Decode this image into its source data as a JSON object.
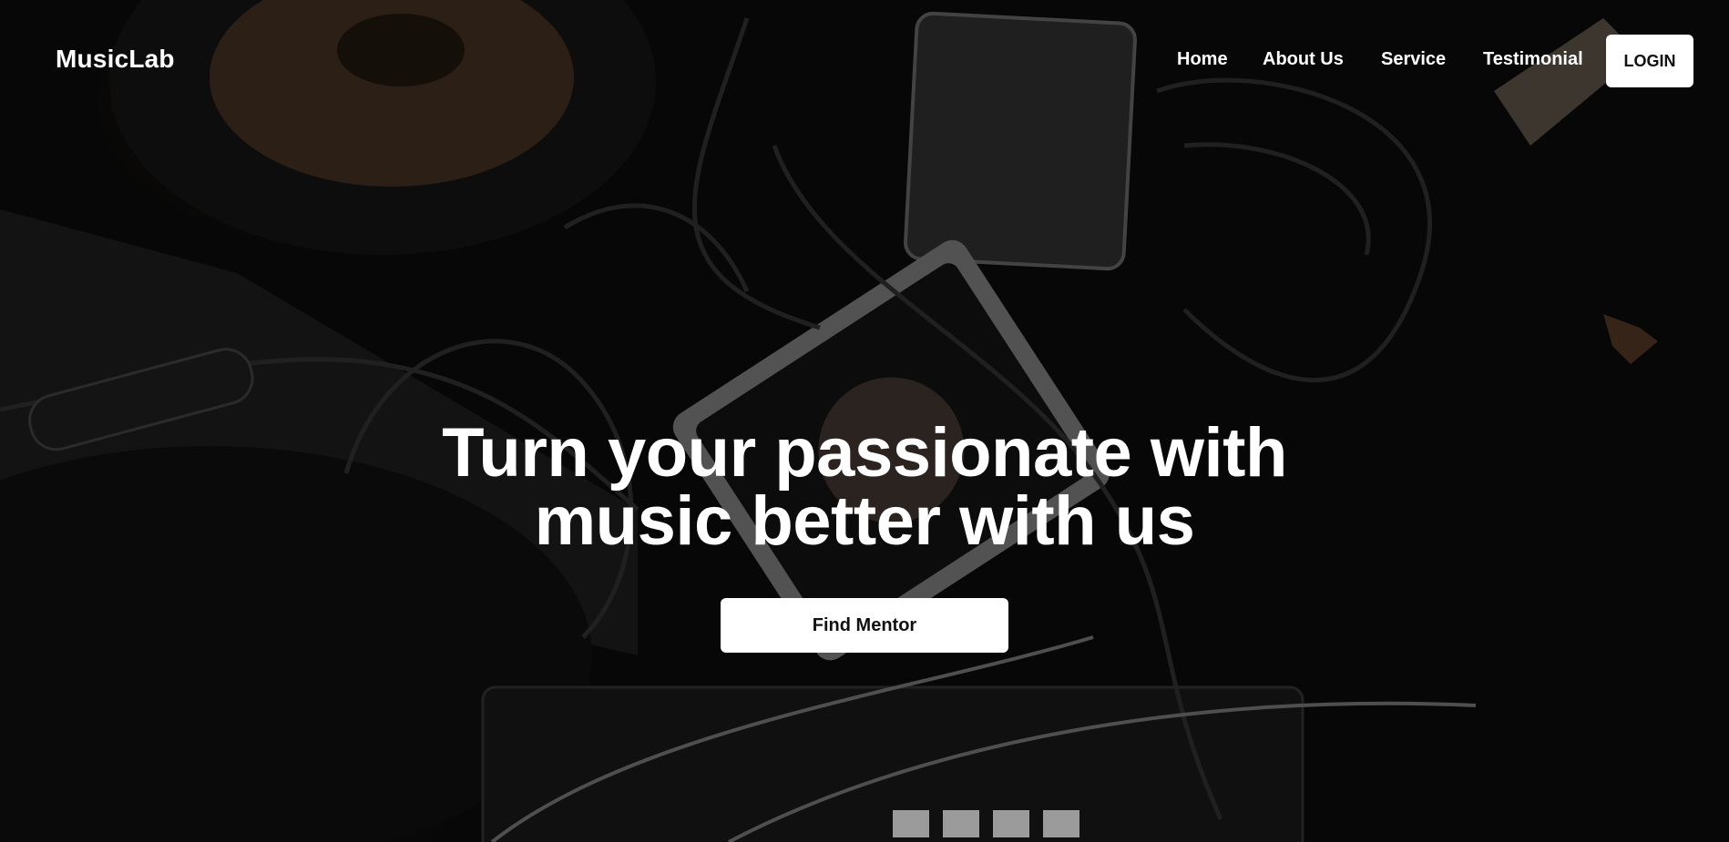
{
  "brand": {
    "name": "MusicLab"
  },
  "nav": {
    "items": [
      {
        "label": "Home"
      },
      {
        "label": "About Us"
      },
      {
        "label": "Service"
      },
      {
        "label": "Testimonial"
      }
    ],
    "login_label": "LOGIN"
  },
  "hero": {
    "headline_line1": "Turn your passionate with",
    "headline_line2": "music better with us",
    "cta_label": "Find Mentor",
    "background_image": "dark photo of music studio equipment: speaker, audio interface, cables, MIDI controller"
  },
  "colors": {
    "text_primary": "#ffffff",
    "button_bg": "#ffffff",
    "button_text": "#111111",
    "background": "#0a0a0a"
  }
}
